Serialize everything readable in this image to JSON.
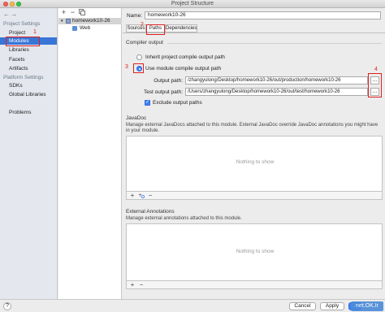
{
  "window": {
    "title": "Project Structure"
  },
  "sidebar": {
    "back_icon": "arrow-left-icon",
    "forward_icon": "arrow-right-icon",
    "project_settings_header": "Project Settings",
    "items": [
      {
        "label": "Project"
      },
      {
        "label": "Modules"
      },
      {
        "label": "Libraries"
      },
      {
        "label": "Facets"
      },
      {
        "label": "Artifacts"
      }
    ],
    "platform_settings_header": "Platform Settings",
    "platform_items": [
      {
        "label": "SDKs"
      },
      {
        "label": "Global Libraries"
      }
    ],
    "problems_label": "Problems"
  },
  "module_tree": {
    "toolbar": {
      "add": "+",
      "remove": "−",
      "copy_icon": "copy-icon"
    },
    "items": [
      {
        "label": "homework10-26"
      },
      {
        "label": "Web"
      }
    ]
  },
  "module": {
    "name_label": "Name:",
    "name_value": "homework10-26",
    "tabs": [
      {
        "label": "Sources"
      },
      {
        "label": "Paths"
      },
      {
        "label": "Dependencies"
      }
    ],
    "compiler_output": {
      "header": "Compiler output",
      "inherit_label": "Inherit project compile output path",
      "use_module_label": "Use module compile output path",
      "output_path_label": "Output path:",
      "output_path_value": "/zhangyulong/Desktop/homework10-26/out/production/homework10-26",
      "test_output_path_label": "Test output path:",
      "test_output_path_value": "/Users/zhangyulong/Desktop/homework10-26/out/test/homework10-26",
      "exclude_label": "Exclude output paths"
    },
    "javadoc": {
      "header": "JavaDoc",
      "description": "Manage external JavaDocs attached to this module. External JavaDoc override JavaDoc annotations you might have in your module.",
      "empty_text": "Nothing to show",
      "add": "+",
      "remove": "−"
    },
    "external_annotations": {
      "header": "External Annotations",
      "description": "Manage external annotations attached to this module.",
      "empty_text": "Nothing to show",
      "add": "+",
      "remove": "−"
    }
  },
  "footer": {
    "help": "?",
    "cancel": "Cancel",
    "apply": "Apply",
    "ok": "OK"
  },
  "annotations": {
    "n1": "1",
    "n2": "2",
    "n3": "3",
    "n4": "4",
    "color": "#e02020"
  },
  "watermark": "net.OK.Ir"
}
